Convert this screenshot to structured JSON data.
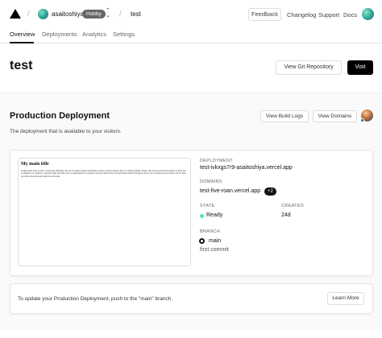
{
  "topbar": {
    "logo": "vercel-triangle-icon",
    "username": "asaitoshiya",
    "plan": "Hobby",
    "project": "test",
    "feedback": "Feedback",
    "links": [
      "Changelog",
      "Support",
      "Docs"
    ]
  },
  "tabs": [
    "Overview",
    "Deployments",
    "Analytics",
    "Settings"
  ],
  "header": {
    "title": "test",
    "repo_button": "View Git Repository",
    "visit_button": "Visit"
  },
  "production": {
    "title": "Production Deployment",
    "subtitle": "The deployment that is available to your visitors.",
    "build_logs": "View Build Logs",
    "view_domains": "View Domains"
  },
  "preview": {
    "title": "My main title",
    "body": "Lorem ipsum dolor sit amet, consectetur adipiscing elit, sed do eiusmod tempor incididunt ut labore et dolore magna aliqua. Ut enim ad minim veniam, quis nostrud exercitation ullamco laboris nisi ut aliquip ex ea commodo consequat. Duis aute irure dolor in reprehenderit in voluptate velit esse cillum dolore eu fugiat nulla pariatur. Excepteur sint occaecat cupidatat non proident, sunt in culpa qui officia deserunt mollit anim id est laborum."
  },
  "deployment": {
    "deployment_label": "DEPLOYMENT",
    "deployment_url": "test-ivkxgs7r9-asaitoshiya.vercel.app",
    "domains_label": "DOMAINS",
    "domain": "test-five-roan.vercel.app",
    "domain_more": "+2",
    "state_label": "STATE",
    "state": "Ready",
    "created_label": "CREATED",
    "created": "24d",
    "branch_label": "BRANCH",
    "branch": "main",
    "commit": "first commit",
    "ready_color": "#50e3c2"
  },
  "info": {
    "text": "To update your Production Deployment, push to the \"main\" branch.",
    "learn_more": "Learn More"
  }
}
